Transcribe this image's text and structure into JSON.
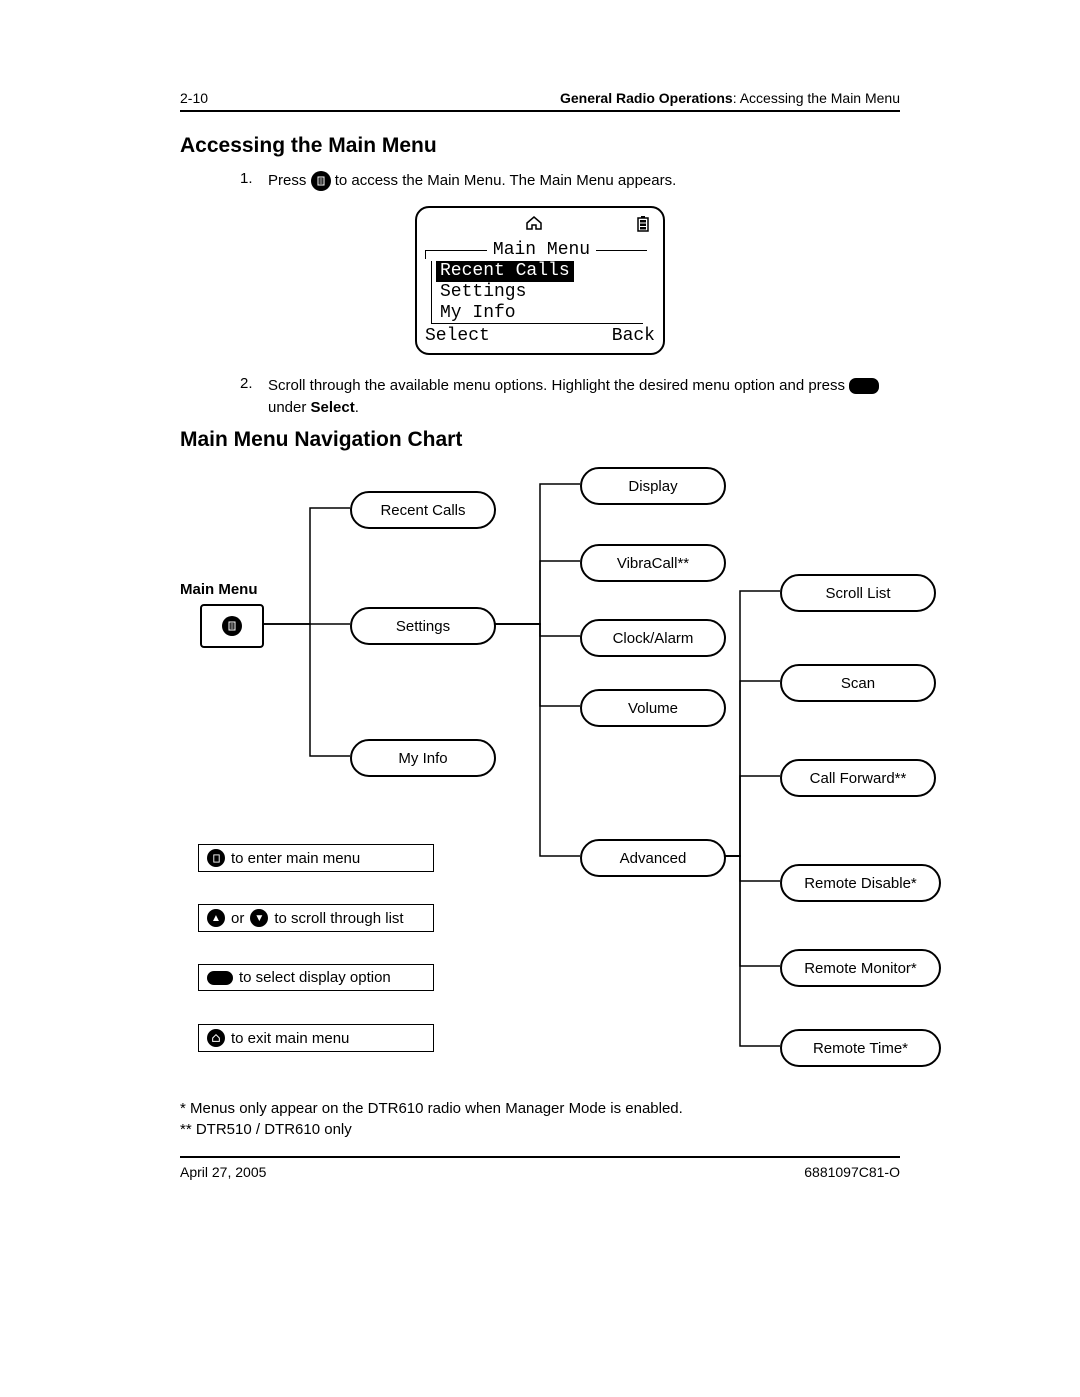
{
  "header": {
    "page_no": "2-10",
    "section_bold": "General Radio Operations",
    "section_rest": ": Accessing the Main Menu"
  },
  "heading1": "Accessing the Main Menu",
  "step1": {
    "num": "1.",
    "pre": "Press ",
    "post": " to access the Main Menu. The Main Menu appears."
  },
  "lcd": {
    "title": "Main Menu",
    "item_hl": "Recent Calls",
    "item2": "Settings",
    "item3": "My Info",
    "soft_left": "Select",
    "soft_right": "Back"
  },
  "step2": {
    "num": "2.",
    "pre": "Scroll through the available menu options. Highlight the desired menu option and press ",
    "post1": " under ",
    "bold": "Select",
    "post2": "."
  },
  "heading2": "Main Menu Navigation Chart",
  "chart": {
    "root_label": "Main Menu",
    "level1": {
      "recent_calls": "Recent Calls",
      "settings": "Settings",
      "my_info": "My Info"
    },
    "level2": {
      "display": "Display",
      "vibracall": "VibraCall**",
      "clock": "Clock/Alarm",
      "volume": "Volume",
      "advanced": "Advanced"
    },
    "level3": {
      "scroll": "Scroll List",
      "scan": "Scan",
      "callfwd": "Call Forward**",
      "rdisable": "Remote Disable*",
      "rmonitor": "Remote Monitor*",
      "rtime": "Remote Time*"
    },
    "legend": {
      "enter": "to enter main menu",
      "or": "or",
      "scroll": "to scroll through list",
      "select": "to select display option",
      "exit": "to exit main menu"
    }
  },
  "footnotes": {
    "f1": "* Menus only appear on the DTR610 radio when Manager Mode is enabled.",
    "f2": "** DTR510 / DTR610 only"
  },
  "footer": {
    "date": "April 27, 2005",
    "docid": "6881097C81-O"
  }
}
